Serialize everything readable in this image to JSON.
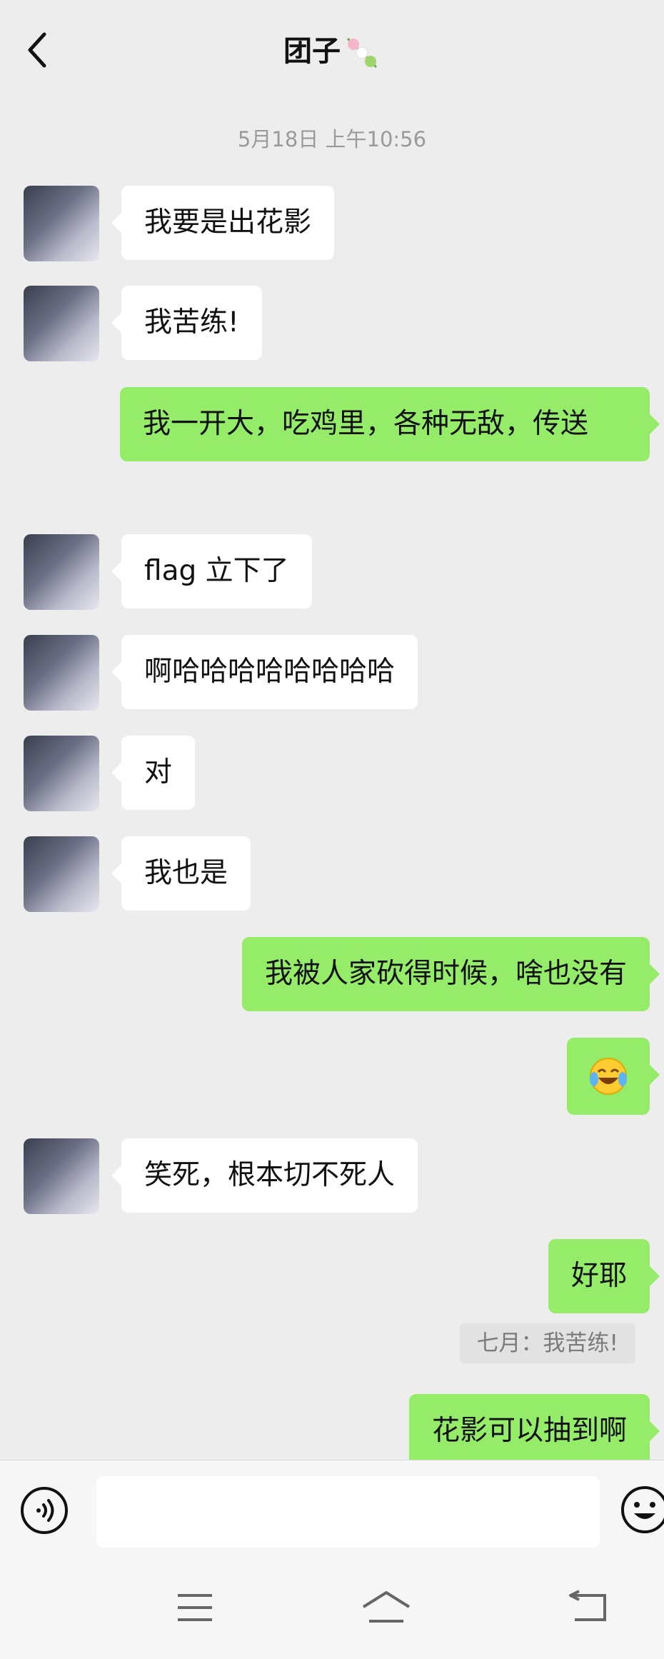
{
  "header": {
    "title": "团子",
    "back_icon": "back-arrow-icon",
    "title_emoji": "dango-icon"
  },
  "timestamp": "5月18日 上午10:56",
  "messages": [
    {
      "side": "in",
      "text": "我要是出花影"
    },
    {
      "side": "in",
      "text": "我苦练!"
    },
    {
      "side": "out",
      "text": "我一开大，吃鸡里，各种无敌，传送"
    },
    {
      "side": "in",
      "text": "flag 立下了"
    },
    {
      "side": "in",
      "text": "啊哈哈哈哈哈哈哈哈"
    },
    {
      "side": "in",
      "text": "对"
    },
    {
      "side": "in",
      "text": "我也是"
    },
    {
      "side": "out",
      "text": "我被人家砍得时候，啥也没有"
    },
    {
      "side": "out",
      "emoji": "laughing-tears-emoji"
    },
    {
      "side": "in",
      "text": "笑死，根本切不死人"
    },
    {
      "side": "out",
      "text": "好耶"
    },
    {
      "side": "out",
      "text": "花影可以抽到啊"
    }
  ],
  "quote": {
    "text": "七月：我苦练!"
  },
  "input": {
    "voice_icon": "voice-icon",
    "emoji_icon": "emoji-icon",
    "value": ""
  },
  "navbar": {
    "icons": [
      "menu-icon",
      "home-icon",
      "back-icon"
    ]
  },
  "colors": {
    "background": "#ededed",
    "outgoing_bubble": "#95ec69",
    "incoming_bubble": "#ffffff"
  }
}
